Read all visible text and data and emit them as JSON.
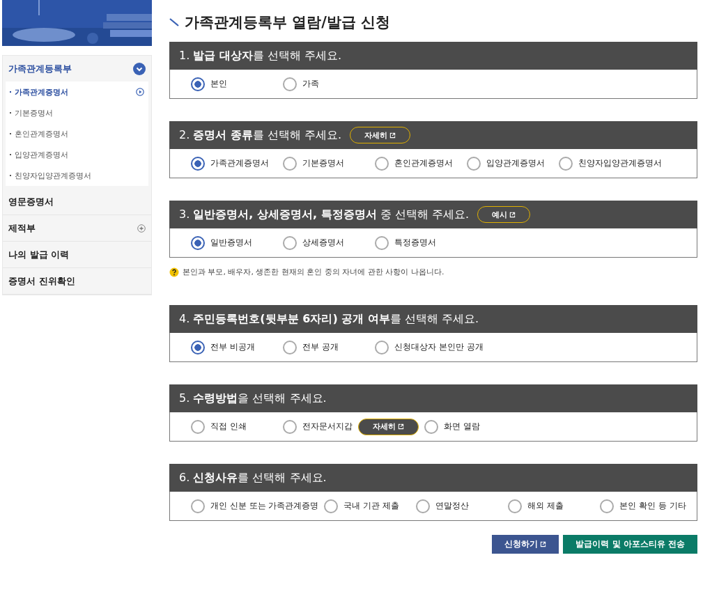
{
  "sidebar": {
    "items": [
      {
        "label": "가족관계등록부",
        "expanded": true,
        "children": [
          {
            "label": "가족관계증명서",
            "selected": true
          },
          {
            "label": "기본증명서",
            "selected": false
          },
          {
            "label": "혼인관계증명서",
            "selected": false
          },
          {
            "label": "입양관계증명서",
            "selected": false
          },
          {
            "label": "친양자입양관계증명서",
            "selected": false
          }
        ]
      },
      {
        "label": "영문증명서"
      },
      {
        "label": "제적부",
        "expanded": false
      },
      {
        "label": "나의 발급 이력"
      },
      {
        "label": "증명서 진위확인"
      }
    ]
  },
  "page_title": "가족관계등록부 열람/발급 신청",
  "sections": [
    {
      "heading": "1. **발급 대상자**를 선택해 주세요.",
      "options": [
        {
          "label": "본인",
          "selected": true
        },
        {
          "label": "가족",
          "selected": false
        }
      ]
    },
    {
      "heading": "2. **증명서 종류**를 선택해 주세요.",
      "button": "자세히",
      "options": [
        {
          "label": "가족관계증명서",
          "selected": true
        },
        {
          "label": "기본증명서",
          "selected": false
        },
        {
          "label": "혼인관계증명서",
          "selected": false
        },
        {
          "label": "입양관계증명서",
          "selected": false
        },
        {
          "label": "친양자입양관계증명서",
          "selected": false
        }
      ]
    },
    {
      "heading": "3. **일반증명서, 상세증명서, 특정증명서** 중 선택해 주세요.",
      "button": "예시",
      "options": [
        {
          "label": "일반증명서",
          "selected": true
        },
        {
          "label": "상세증명서",
          "selected": false
        },
        {
          "label": "특정증명서",
          "selected": false
        }
      ],
      "note": "본인과 부모, 배우자, 생존한 현재의 혼인 중의 자녀에 관한 사항이 나옵니다."
    },
    {
      "heading": "4. **주민등록번호(뒷부분 6자리) 공개 여부**를 선택해 주세요.",
      "options": [
        {
          "label": "전부 비공개",
          "selected": true
        },
        {
          "label": "전부 공개",
          "selected": false
        },
        {
          "label": "신청대상자 본인만 공개",
          "selected": false
        }
      ]
    },
    {
      "heading": "5. **수령방법**을 선택해 주세요.",
      "options": [
        {
          "label": "직접 인쇄",
          "selected": false
        },
        {
          "label": "전자문서지갑",
          "selected": false,
          "button": "자세히"
        },
        {
          "label": "화면 열람",
          "selected": false
        }
      ]
    },
    {
      "heading": "6. **신청사유**를 선택해 주세요.",
      "options": [
        {
          "label": "개인 신분 또는 가족관계증명",
          "selected": false
        },
        {
          "label": "국내 기관 제출",
          "selected": false
        },
        {
          "label": "연말정산",
          "selected": false
        },
        {
          "label": "해외 제출",
          "selected": false
        },
        {
          "label": "본인 확인 등 기타",
          "selected": false
        }
      ]
    }
  ],
  "actions": [
    {
      "label": "신청하기",
      "kind": "primary",
      "external": true
    },
    {
      "label": "발급이력 및 아포스티유 전송",
      "kind": "secondary",
      "external": false
    }
  ]
}
